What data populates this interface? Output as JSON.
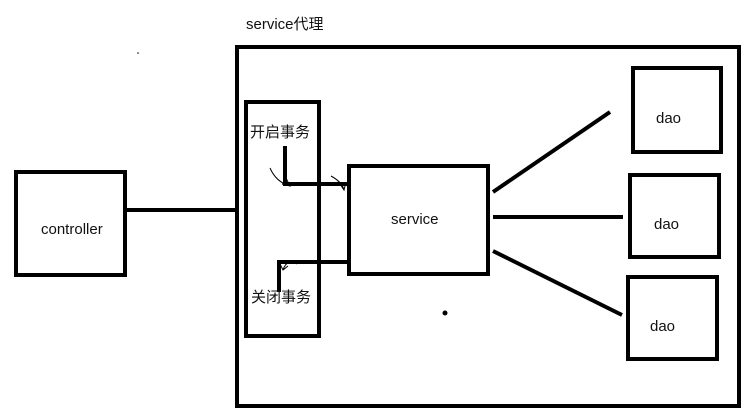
{
  "diagram": {
    "proxy_title": "service代理",
    "controller": "controller",
    "open_tx": "开启事务",
    "close_tx": "关闭事务",
    "service": "service",
    "daos": [
      "dao",
      "dao",
      "dao"
    ]
  },
  "colors": {
    "stroke": "#000000",
    "text": "#111111",
    "background": "#ffffff"
  }
}
